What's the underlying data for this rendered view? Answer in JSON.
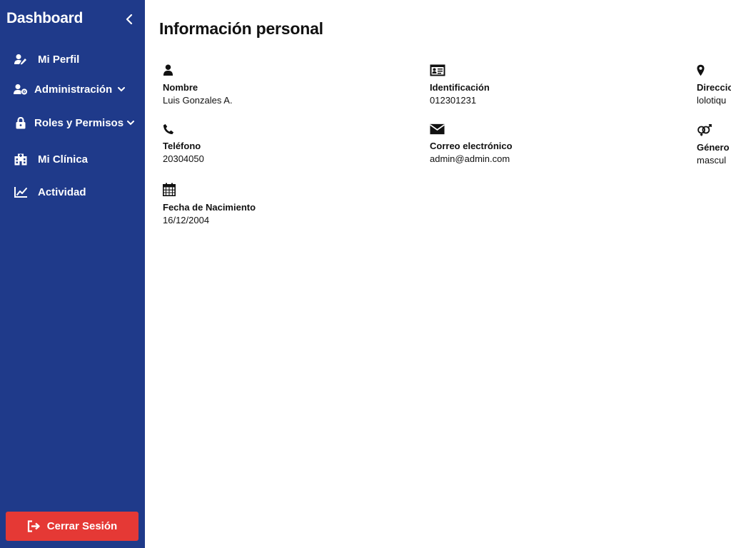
{
  "sidebar": {
    "brand": "Dashboard",
    "items": [
      {
        "label": "Mi Perfil",
        "icon": "user-edit-icon"
      },
      {
        "label": "Administración",
        "icon": "user-cog-icon",
        "has_dropdown": true
      },
      {
        "label": "Roles y Permisos",
        "icon": "lock-icon",
        "has_dropdown": true
      },
      {
        "label": "Mi Clínica",
        "icon": "hospital-icon"
      },
      {
        "label": "Actividad",
        "icon": "chart-line-icon"
      }
    ],
    "logout_label": "Cerrar Sesión"
  },
  "main": {
    "title": "Información personal",
    "fields": {
      "nombre": {
        "label": "Nombre",
        "value": "Luis Gonzales A.",
        "icon": "user-icon"
      },
      "identificacion": {
        "label": "Identificación",
        "value": "012301231",
        "icon": "id-card-icon"
      },
      "direccion": {
        "label": "Direccio",
        "value": "lolotiqu",
        "icon": "map-marker-icon"
      },
      "telefono": {
        "label": "Teléfono",
        "value": "20304050",
        "icon": "phone-icon"
      },
      "correo": {
        "label": "Correo electrónico",
        "value": "admin@admin.com",
        "icon": "envelope-icon"
      },
      "genero": {
        "label": "Género",
        "value": "mascul",
        "icon": "gender-icon"
      },
      "nacimiento": {
        "label": "Fecha de Nacimiento",
        "value": "16/12/2004",
        "icon": "calendar-icon"
      }
    }
  },
  "colors": {
    "sidebar_bg": "#1f3a8a",
    "logout_bg": "#e53935"
  }
}
